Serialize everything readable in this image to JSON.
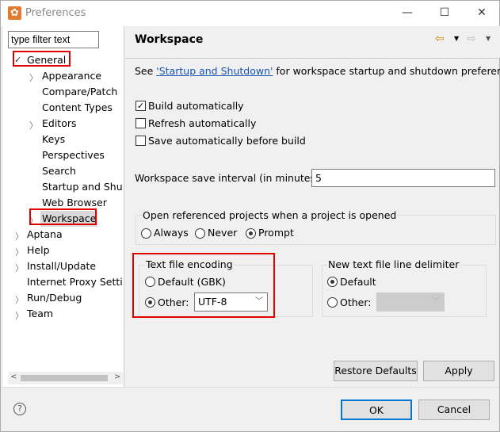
{
  "window": {
    "title": "Preferences",
    "minimize": "—",
    "maximize": "☐",
    "close": "✕"
  },
  "filter": {
    "value": "type filter text"
  },
  "tree": [
    {
      "label": "General",
      "expanded": true
    },
    {
      "label": "Appearance"
    },
    {
      "label": "Compare/Patch"
    },
    {
      "label": "Content Types"
    },
    {
      "label": "Editors"
    },
    {
      "label": "Keys"
    },
    {
      "label": "Perspectives"
    },
    {
      "label": "Search"
    },
    {
      "label": "Startup and Shutdown"
    },
    {
      "label": "Web Browser"
    },
    {
      "label": "Workspace",
      "selected": true
    },
    {
      "label": "Aptana"
    },
    {
      "label": "Help"
    },
    {
      "label": "Install/Update"
    },
    {
      "label": "Internet Proxy Settings"
    },
    {
      "label": "Run/Debug"
    },
    {
      "label": "Team"
    }
  ],
  "page": {
    "title": "Workspace",
    "see_prefix": "See ",
    "see_link": "'Startup and Shutdown'",
    "see_suffix": " for workspace startup and shutdown preferences.",
    "build_auto": {
      "label": "Build automatically",
      "checked": true
    },
    "refresh_auto": {
      "label": "Refresh automatically",
      "checked": false
    },
    "save_auto": {
      "label": "Save automatically before build",
      "checked": false
    },
    "save_interval_label": "Workspace save interval (in minutes):",
    "save_interval_value": "5",
    "open_ref_label": "Open referenced projects when a project is opened",
    "open_ref_options": [
      "Always",
      "Never",
      "Prompt"
    ],
    "open_ref_selected": "Prompt",
    "encoding": {
      "title": "Text file encoding",
      "default_label": "Default (GBK)",
      "other_label": "Other:",
      "value": "UTF-8",
      "selected": "Other"
    },
    "delimiter": {
      "title": "New text file line delimiter",
      "default_label": "Default",
      "other_label": "Other:",
      "value": "",
      "selected": "Default"
    },
    "restore_defaults": "Restore Defaults",
    "apply": "Apply"
  },
  "footer": {
    "help": "?",
    "ok": "OK",
    "cancel": "Cancel"
  },
  "colors": {
    "highlight": "#e00000",
    "link": "#1a55b0",
    "ok_border": "#0078d7"
  }
}
